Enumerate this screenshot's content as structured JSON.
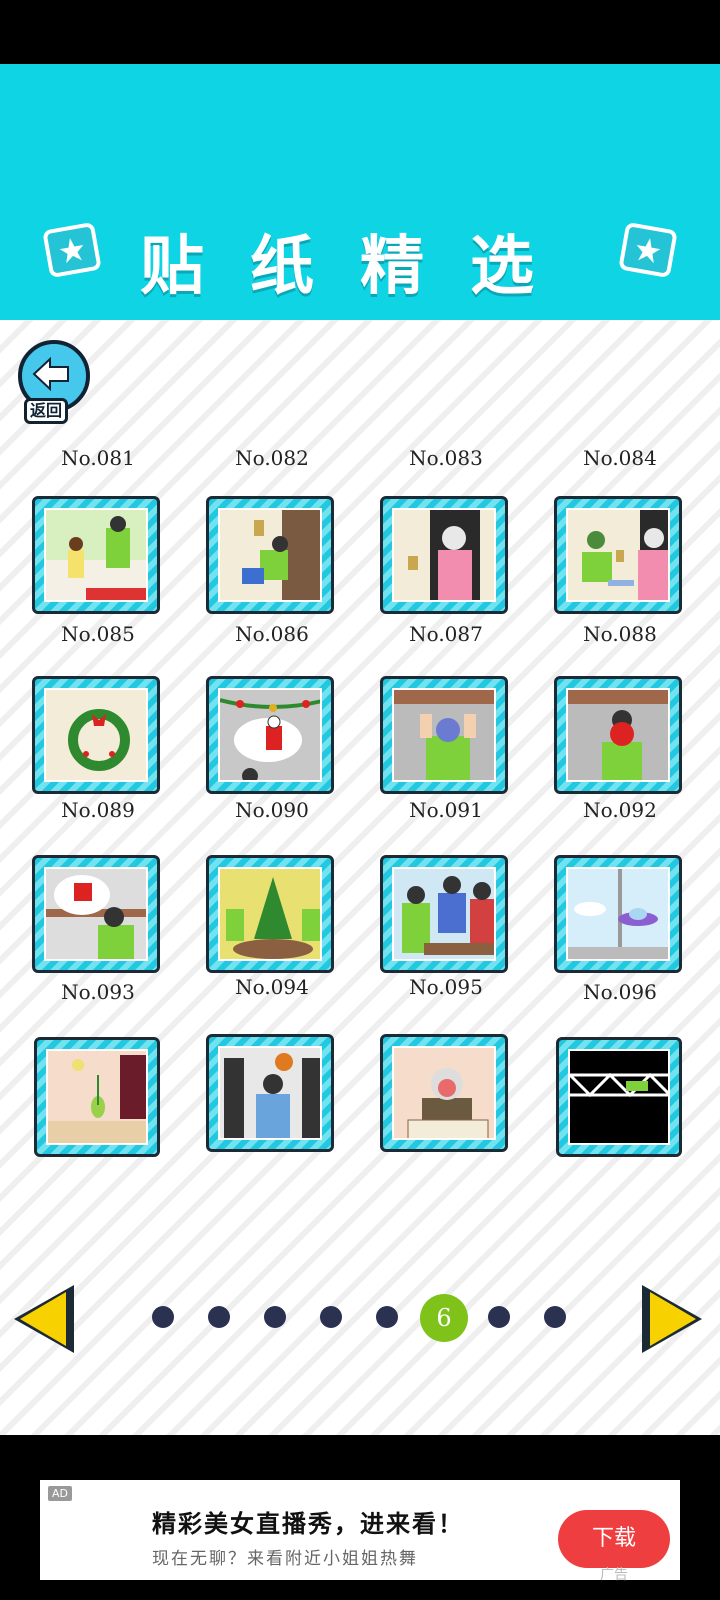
{
  "header": {
    "title": "贴纸精选"
  },
  "back": {
    "label": "返回"
  },
  "stickers": [
    {
      "no": "No.081"
    },
    {
      "no": "No.082"
    },
    {
      "no": "No.083"
    },
    {
      "no": "No.084"
    },
    {
      "no": "No.085"
    },
    {
      "no": "No.086"
    },
    {
      "no": "No.087"
    },
    {
      "no": "No.088"
    },
    {
      "no": "No.089"
    },
    {
      "no": "No.090"
    },
    {
      "no": "No.091"
    },
    {
      "no": "No.092"
    },
    {
      "no": "No.093"
    },
    {
      "no": "No.094"
    },
    {
      "no": "No.095"
    },
    {
      "no": "No.096"
    }
  ],
  "pagination": {
    "current": "6",
    "total_pages": 8,
    "current_index": 6
  },
  "ad": {
    "badge": "AD",
    "title": "精彩美女直播秀，进来看！",
    "subtitle": "现在无聊？来看附近小姐姐热舞",
    "button": "下载",
    "tag": "广告"
  },
  "colors": {
    "header": "#0fd4e4",
    "card_border": "#22c8e0",
    "active_dot": "#7fc31a",
    "arrow": "#f7d200",
    "ad_button": "#ef3e40"
  }
}
